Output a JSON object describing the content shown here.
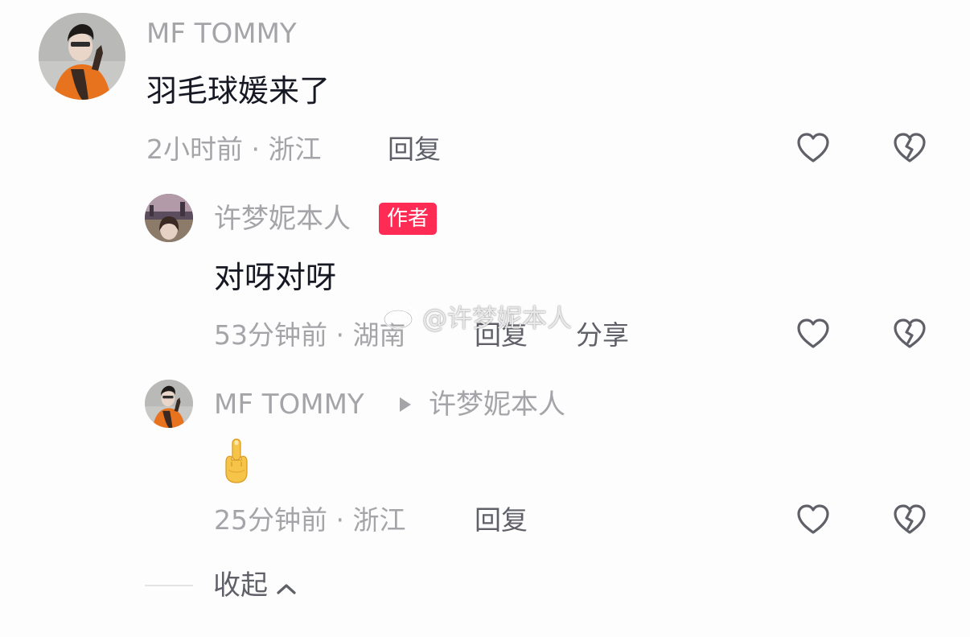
{
  "comments": [
    {
      "username": "MF TOMMY",
      "text": "羽毛球媛来了",
      "meta": "2小时前 · 浙江",
      "reply_label": "回复"
    }
  ],
  "replies": [
    {
      "username": "许梦妮本人",
      "badge": "作者",
      "text": "对呀对呀",
      "meta": "53分钟前 · 湖南",
      "reply_label": "回复",
      "share_label": "分享"
    },
    {
      "username": "MF TOMMY",
      "reply_to": "许梦妮本人",
      "meta": "25分钟前 · 浙江",
      "reply_label": "回复"
    }
  ],
  "watermark": "@许梦妮本人",
  "collapse_label": "收起",
  "icons": {
    "like": "heart-outline-icon",
    "dislike": "broken-heart-icon",
    "reply_arrow": "triangle-right-icon",
    "collapse": "chevron-up-icon",
    "emoji": "middle-finger-emoji"
  },
  "colors": {
    "badge": "#fe2c55",
    "text_primary": "#161823",
    "text_secondary": "#a5a5a9",
    "action_text": "#5f6068"
  }
}
